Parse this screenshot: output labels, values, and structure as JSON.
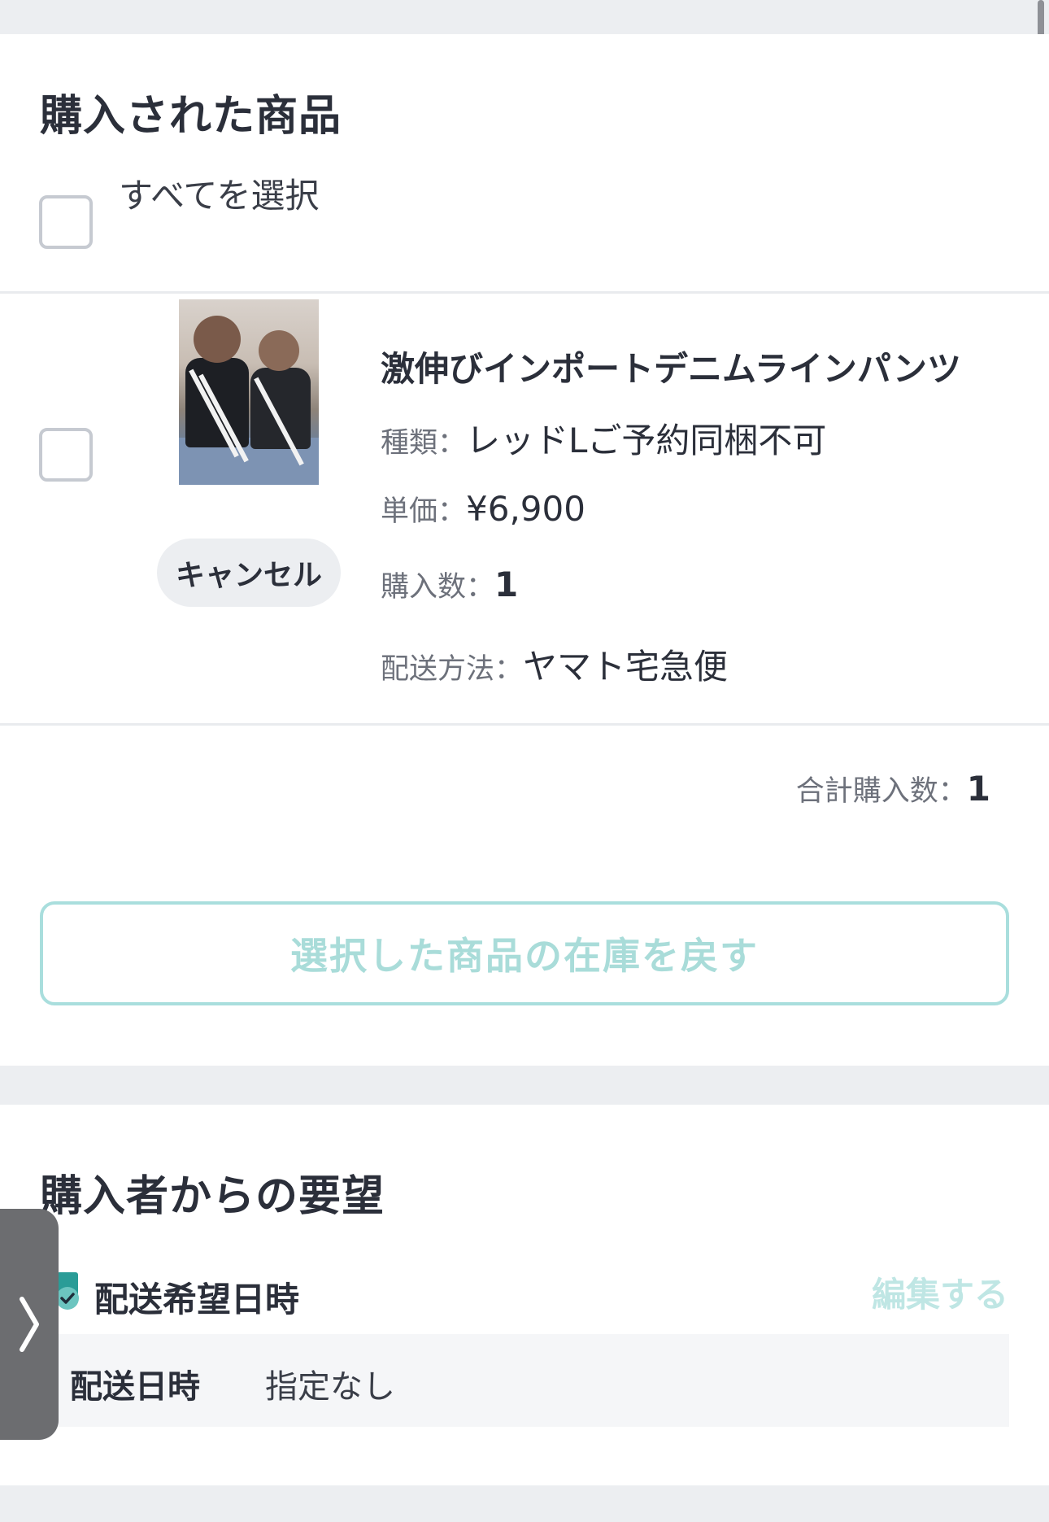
{
  "products_section": {
    "title": "購入された商品",
    "select_all_label": "すべてを選択",
    "item": {
      "name": "激伸びインポートデニムラインパンツ",
      "variant_key": "種類：",
      "variant_value": "レッドLご予約同梱不可",
      "price_key": "単価：",
      "price_value": "¥6,900",
      "qty_key": "購入数：",
      "qty_value": "1",
      "shipping_key": "配送方法：",
      "shipping_value": "ヤマト宅急便",
      "cancel_label": "キャンセル"
    },
    "total_key": "合計購入数：",
    "total_value": "1",
    "restock_button": "選択した商品の在庫を戻す"
  },
  "requests_section": {
    "title": "購入者からの要望",
    "delivery_title": "配送希望日時",
    "edit_label": "編集する",
    "delivery_label": "配送日時",
    "delivery_value": "指定なし"
  },
  "colors": {
    "accent_teal": "#a9dedd",
    "background": "#eceef1",
    "text": "#2b2f3a"
  }
}
